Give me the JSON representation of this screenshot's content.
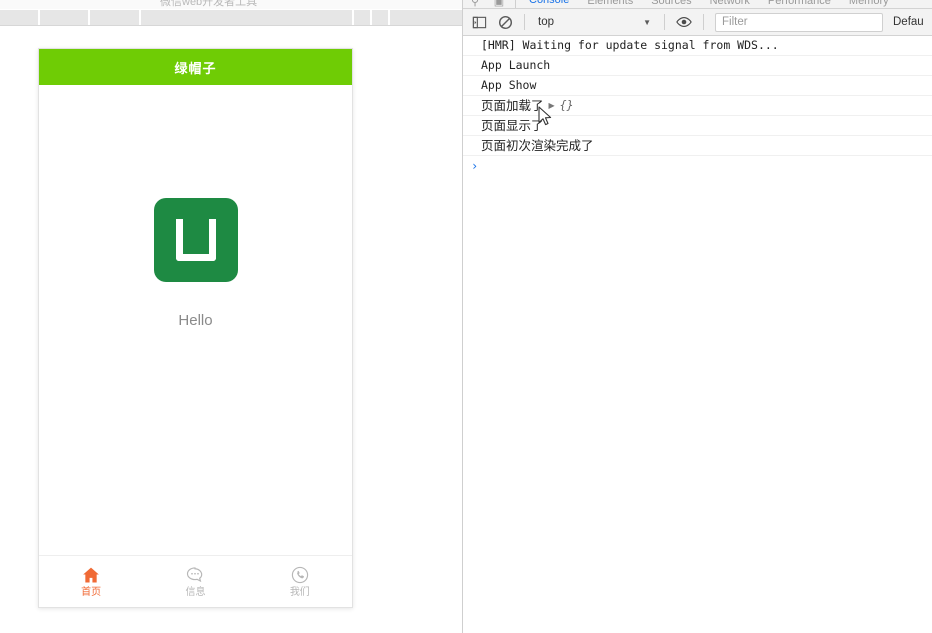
{
  "ide": {
    "toolbar_ghost_text": "微信web开发者工具",
    "strip_name": "ide-secondary-toolbar"
  },
  "simulator": {
    "nav_title": "绿帽子",
    "nav_bg": "#6fcc05",
    "logo": {
      "icon_name": "app-logo-u",
      "bg": "#1e8a43",
      "caption": "Hello"
    },
    "tabbar": {
      "active_color": "#f06a35",
      "inactive_color": "#b7b7b7",
      "items": [
        {
          "label": "首页",
          "icon": "home-icon",
          "active": true
        },
        {
          "label": "信息",
          "icon": "chat-bubble-icon",
          "active": false
        },
        {
          "label": "我们",
          "icon": "phone-circle-icon",
          "active": false
        }
      ]
    }
  },
  "devtools": {
    "tabs": [
      {
        "label": "Console",
        "selected": true
      },
      {
        "label": "Elements",
        "selected": false
      },
      {
        "label": "Sources",
        "selected": false
      },
      {
        "label": "Network",
        "selected": false
      },
      {
        "label": "Performance",
        "selected": false
      },
      {
        "label": "Memory",
        "selected": false
      }
    ],
    "toolbar": {
      "sidebar_toggle_icon": "console-sidebar-icon",
      "clear_icon": "clear-console-icon",
      "context_value": "top",
      "caret_icon": "chevron-down-icon",
      "eye_icon": "live-expression-eye-icon",
      "filter_placeholder": "Filter",
      "filter_value": "",
      "levels_label": "Defau"
    },
    "messages": [
      {
        "text": "[HMR] Waiting for update signal from WDS...",
        "cjk": false,
        "object": null
      },
      {
        "text": "App Launch",
        "cjk": false,
        "object": null
      },
      {
        "text": "App Show",
        "cjk": false,
        "object": null
      },
      {
        "text": "页面加载了",
        "cjk": true,
        "object": "{}"
      },
      {
        "text": "页面显示了",
        "cjk": true,
        "object": null
      },
      {
        "text": "页面初次渲染完成了",
        "cjk": true,
        "object": null
      }
    ],
    "prompt_symbol": "›"
  }
}
